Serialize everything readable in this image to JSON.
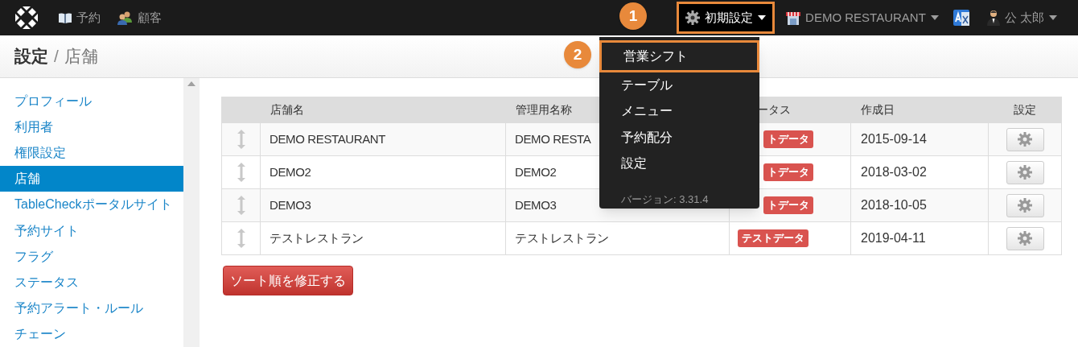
{
  "navbar": {
    "items": [
      {
        "kind": "book",
        "label": "予約"
      },
      {
        "kind": "people",
        "label": "顧客"
      }
    ],
    "settings_menu": {
      "label": "初期設定",
      "open": true
    },
    "restaurant": {
      "label": "DEMO RESTAURANT"
    },
    "user": {
      "label": "公 太郎"
    }
  },
  "callouts": [
    "1",
    "2"
  ],
  "dropdown": {
    "items": [
      {
        "label": "営業シフト",
        "highlighted": true
      },
      {
        "label": "テーブル",
        "highlighted": false
      },
      {
        "label": "メニュー",
        "highlighted": false
      },
      {
        "label": "予約配分",
        "highlighted": false
      },
      {
        "label": "設定",
        "highlighted": false
      }
    ],
    "version": "バージョン: 3.31.4"
  },
  "breadcrumb": {
    "section": "設定",
    "separator": "/",
    "page": "店舗"
  },
  "sidebar": {
    "items": [
      {
        "label": "プロフィール",
        "selected": false
      },
      {
        "label": "利用者",
        "selected": false
      },
      {
        "label": "権限設定",
        "selected": false
      },
      {
        "label": "店舗",
        "selected": true
      },
      {
        "label": "TableCheckポータルサイト",
        "selected": false
      },
      {
        "label": "予約サイト",
        "selected": false
      },
      {
        "label": "フラグ",
        "selected": false
      },
      {
        "label": "ステータス",
        "selected": false
      },
      {
        "label": "予約アラート・ルール",
        "selected": false
      },
      {
        "label": "チェーン",
        "selected": false
      }
    ]
  },
  "table": {
    "columns": [
      "店舗名",
      "管理用名称",
      "ータス",
      "作成日",
      "設定"
    ],
    "rows": [
      {
        "name": "DEMO RESTAURANT",
        "admin_name": "DEMO RESTA",
        "status": "トデータ",
        "created": "2015-09-14"
      },
      {
        "name": "DEMO2",
        "admin_name": "DEMO2",
        "status": "トデータ",
        "created": "2018-03-02"
      },
      {
        "name": "DEMO3",
        "admin_name": "DEMO3",
        "status": "トデータ",
        "created": "2018-10-05"
      },
      {
        "name": "テストレストラン",
        "admin_name": "テストレストラン",
        "status": "テストデータ",
        "created": "2019-04-11"
      }
    ]
  },
  "sort_button": "ソート順を修正する"
}
